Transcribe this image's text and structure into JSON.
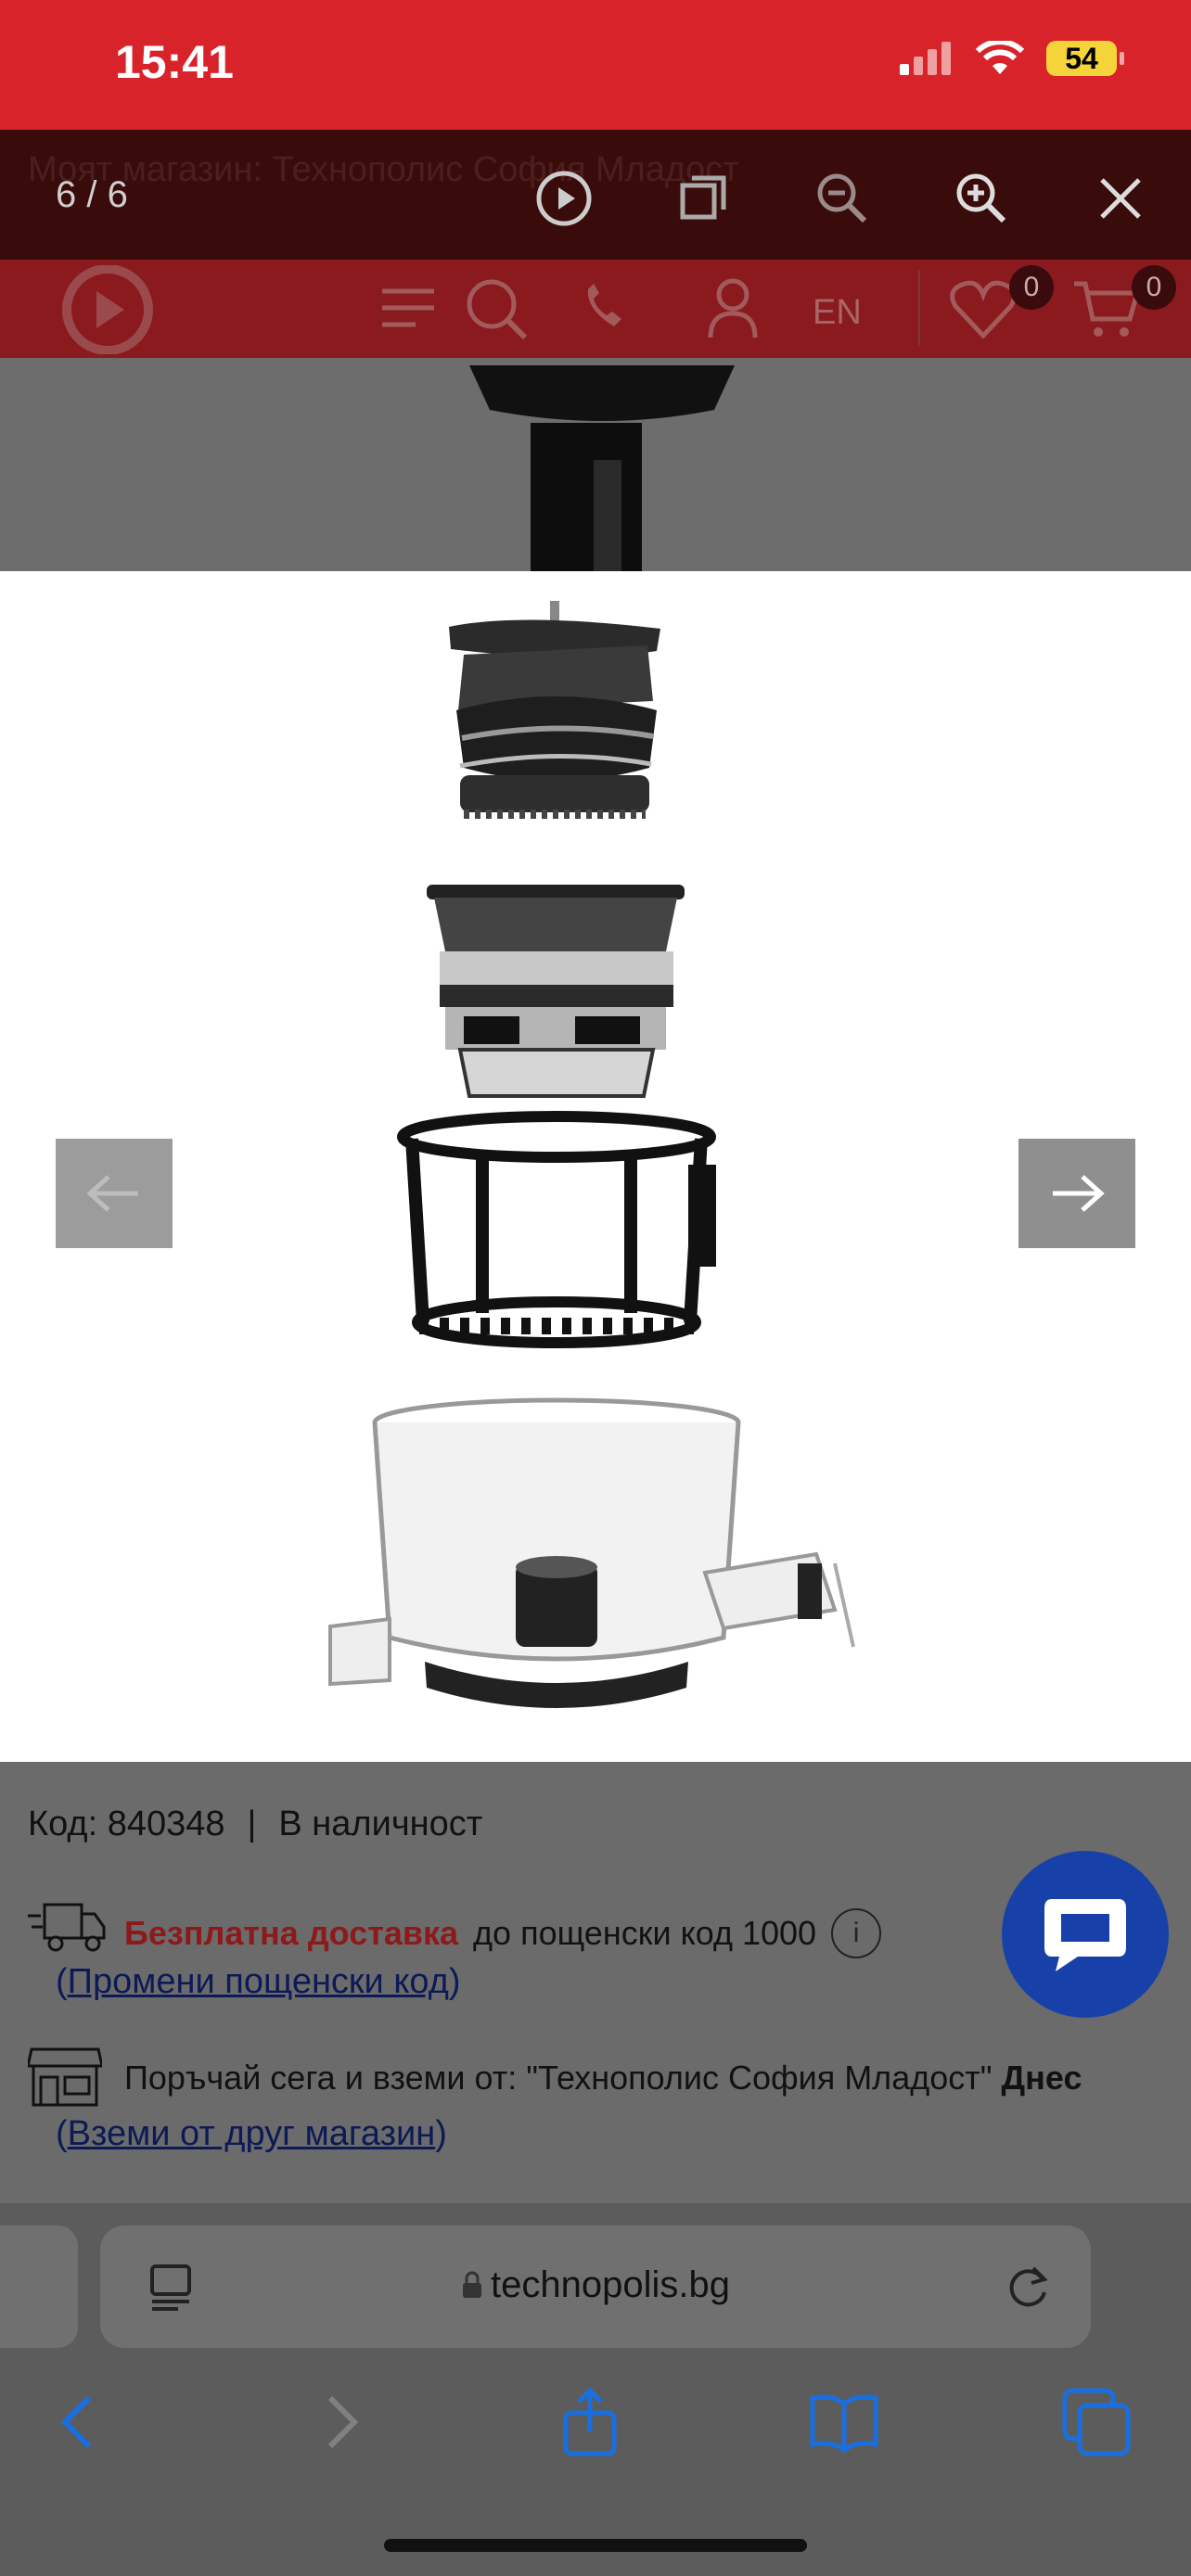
{
  "status": {
    "time": "15:41",
    "battery": "54"
  },
  "store_bar": {
    "title": "Моят магазин: Технополис София Младост"
  },
  "viewer": {
    "counter": "6 / 6"
  },
  "header": {
    "lang": "EN",
    "wishlist_count": "0",
    "cart_count": "0"
  },
  "product": {
    "code_label": "Код: 840348",
    "separator": "|",
    "availability": "В наличност",
    "free_delivery": "Безплатна доставка",
    "delivery_text": "до пощенски код 1000",
    "info_icon": "i",
    "change_postcode_link": "Промени пощенски код",
    "pickup_text": "Поръчай сега и вземи от:  \"Технополис София Младост\"",
    "pickup_when": "Днес",
    "other_store_link": "Вземи от друг магазин"
  },
  "browser": {
    "url": "technopolis.bg"
  },
  "colors": {
    "brand_red": "#d8232a",
    "chat_blue": "#1740a8"
  }
}
